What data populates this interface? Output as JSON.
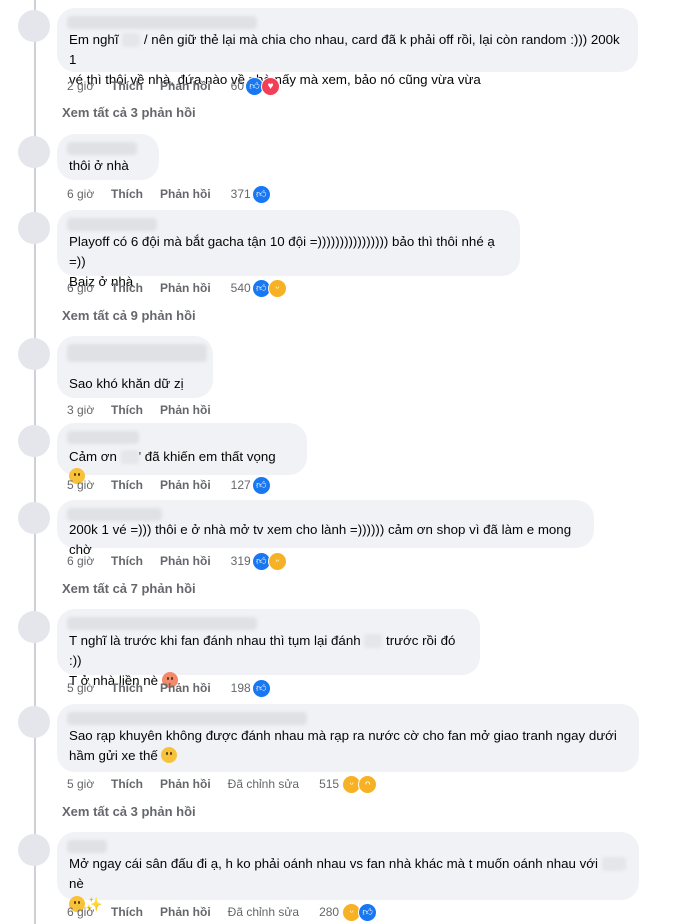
{
  "comments": [
    {
      "text_parts": [
        "Em nghĩ ",
        " / nên giữ thẻ lại mà chia cho nhau, card đã k phải off rồi, lại còn random :))) 200k 1\nvé thì thôi về nhà, đứa nào về nhà nấy mà xem, bảo nó cũng vừa vừa"
      ],
      "time": "2 giờ",
      "like": "Thích",
      "reply": "Phản hồi",
      "count": "60",
      "reactions": [
        "like",
        "love"
      ]
    },
    {
      "text_parts": [
        "thôi ở nhà"
      ],
      "time": "6 giờ",
      "like": "Thích",
      "reply": "Phản hồi",
      "count": "371",
      "reactions": [
        "like"
      ]
    },
    {
      "text_parts": [
        "Playoff có 6 đội mà bắt gacha tận 10 đội =)))))))))))))))) bảo thì thôi nhé ạ =))\nBaiz ở nhà"
      ],
      "time": "6 giờ",
      "like": "Thích",
      "reply": "Phản hồi",
      "count": "540",
      "reactions": [
        "like",
        "haha"
      ]
    },
    {
      "text_parts": [
        "Sao khó khăn dữ zị"
      ],
      "time": "3 giờ",
      "like": "Thích",
      "reply": "Phản hồi",
      "count": "",
      "reactions": []
    },
    {
      "text_parts": [
        "Cảm ơn ",
        "' đã khiến em thất vọng "
      ],
      "time": "5 giờ",
      "like": "Thích",
      "reply": "Phản hồi",
      "count": "127",
      "reactions": [
        "like"
      ]
    },
    {
      "text_parts": [
        "200k 1 vé =))) thôi e ở nhà mở tv xem cho lành =)))))) cảm ơn shop vì đã làm e mong chờ"
      ],
      "time": "6 giờ",
      "like": "Thích",
      "reply": "Phản hồi",
      "count": "319",
      "reactions": [
        "like",
        "haha"
      ]
    },
    {
      "text_parts": [
        "T nghĩ là trước khi fan đánh nhau thì tụm lại đánh ",
        " trước rồi đó :))\nT ở nhà liền nè "
      ],
      "time": "5 giờ",
      "like": "Thích",
      "reply": "Phản hồi",
      "count": "198",
      "reactions": [
        "like"
      ]
    },
    {
      "text_parts": [
        "Sao rạp khuyên không được đánh nhau mà rạp ra nước cờ cho fan mở giao tranh ngay dưới\nhầm gửi xe thế "
      ],
      "time": "5 giờ",
      "like": "Thích",
      "reply": "Phản hồi",
      "edited": "Đã chỉnh sửa",
      "count": "515",
      "reactions": [
        "haha",
        "sad"
      ]
    },
    {
      "text_parts": [
        "Mở ngay cái sân đấu đi ạ, h ko phải oánh nhau vs fan nhà khác mà t muốn oánh nhau với ",
        " nè\n"
      ],
      "time": "6 giờ",
      "like": "Thích",
      "reply": "Phản hồi",
      "edited": "Đã chỉnh sửa",
      "count": "280",
      "reactions": [
        "haha",
        "like"
      ]
    }
  ],
  "view_replies": [
    "Xem tất cả 3 phản hồi",
    "Xem tất cả 9 phản hồi",
    "Xem tất cả 7 phản hồi",
    "Xem tất cả 3 phản hồi"
  ],
  "colors": {
    "like": "#1877f2",
    "love": "#f33e58",
    "haha": "#f7b125"
  }
}
